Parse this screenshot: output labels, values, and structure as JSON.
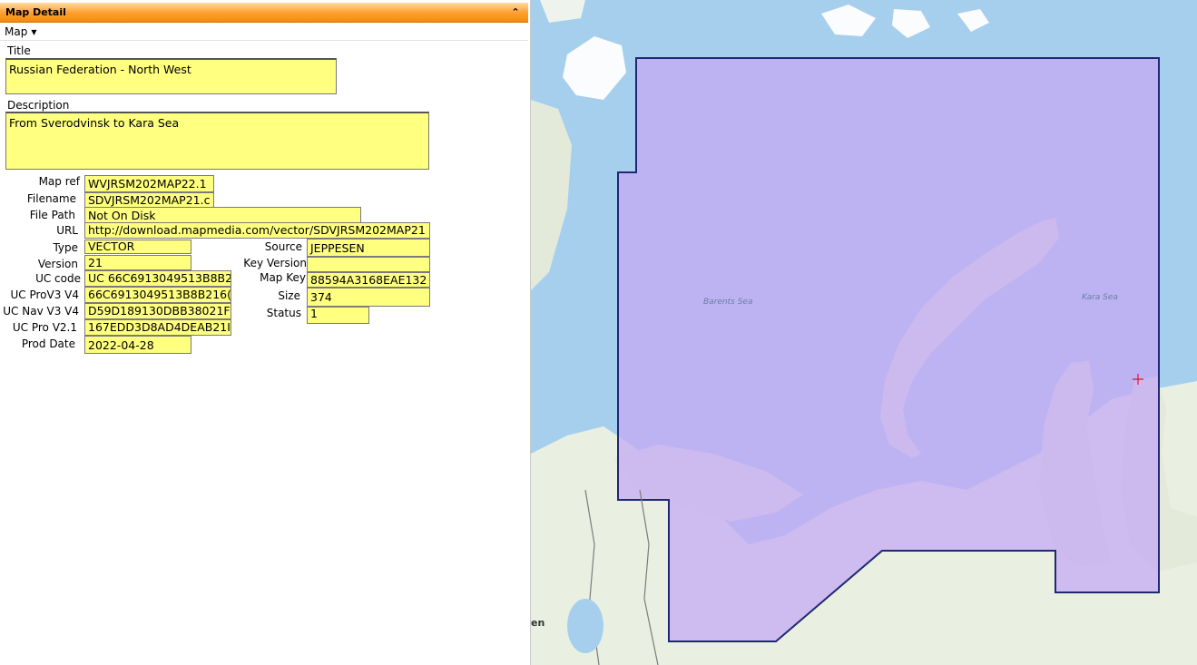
{
  "panel": {
    "title": "Map Detail",
    "collapse_icon": "chevron-double-up-icon",
    "menu": {
      "label": "Map"
    }
  },
  "form": {
    "title_label": "Title",
    "title_value": "Russian Federation - North West",
    "description_label": "Description",
    "description_value": "From Sverodvinsk to Kara Sea",
    "map_ref_label": "Map ref",
    "map_ref_value": "WVJRSM202MAP22.1",
    "filename_label": "Filename",
    "filename_value": "SDVJRSM202MAP21.c",
    "file_path_label": "File Path",
    "file_path_value": "Not On Disk",
    "url_label": "URL",
    "url_value": "http://download.mapmedia.com/vector/SDVJRSM202MAP21",
    "type_label": "Type",
    "type_value": "VECTOR",
    "version_label": "Version",
    "version_value": "21",
    "uc_code_label": "UC code",
    "uc_code_value": "UC 66C6913049513B8B2",
    "uc_prov3_label": "UC ProV3 V4",
    "uc_prov3_value": "66C6913049513B8B216(",
    "uc_nav_label": "UC Nav V3 V4",
    "uc_nav_value": "D59D189130DBB38021F",
    "uc_pro_label": "UC Pro V2.1",
    "uc_pro_value": "167EDD3D8AD4DEAB21I",
    "prod_date_label": "Prod Date",
    "prod_date_value": "2022-04-28",
    "source_label": "Source",
    "source_value": "JEPPESEN",
    "key_version_label": "Key Version",
    "key_version_value": "",
    "map_key_label": "Map Key",
    "map_key_value": "88594A3168EAE132",
    "size_label": "Size",
    "size_value": "374",
    "status_label": "Status",
    "status_value": "1"
  },
  "map": {
    "labels": {
      "barents": "Barents Sea",
      "kara": "Kara Sea",
      "edge_text": "en"
    },
    "colors": {
      "sea": "#a6cfee",
      "land": "#e9efe1",
      "coverage_fill": "#c4a9f4",
      "coverage_stroke": "#1f2870",
      "marker": "#e0152d"
    }
  }
}
